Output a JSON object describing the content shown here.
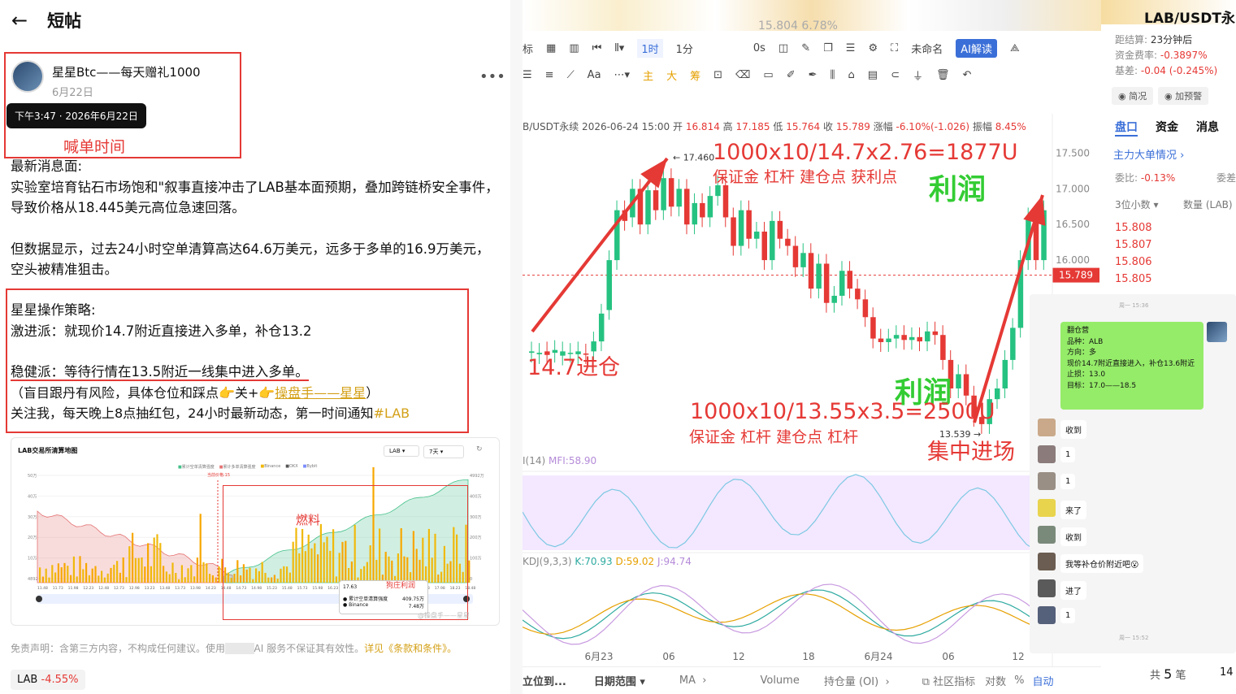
{
  "post": {
    "title": "短帖",
    "author_name": "星星Btc——每天赠礼1000",
    "author_date": "6月22日",
    "tooltip_time": "下午3:47 · 2026年6月22日",
    "annotation_time": "喊单时间",
    "p1": "最新消息面:",
    "p2": "实验室培育钻石市场饱和\"叙事直接冲击了LAB基本面预期，叠加跨链桥安全事件，导致价格从18.445美元高位急速回落。",
    "p3": "但数据显示，过去24小时空单清算高达64.6万美元，远多于多单的16.9万美元，空头被精准狙击。",
    "strategy_title": "星星操作策略:",
    "s1": "激进派：就现价14.7附近直接进入多单，补仓13.2",
    "s2": "稳健派：等待行情在13.5附近一线集中进入多单。",
    "s3a": "（盲目跟丹有风险，具体仓位和踩点",
    "s3b": "关+",
    "s3c": "操盘手——星星",
    "s3d": "）",
    "s4a": "关注我，每天晚上8点抽红包，24小时最新动态，第一时间通知",
    "s4b": "#LAB",
    "heatmap_title": "LAB交易所清算地图",
    "heatmap_label": "燃料",
    "heatmap_annot": "狗庄利润",
    "heatmap_sel1": "LAB",
    "heatmap_sel2": "7天",
    "heatmap_tip_price": "17.63",
    "heatmap_tip_v1": "409.75万",
    "heatmap_tip_v2": "7.48万",
    "heatmap_legend": [
      "累计空单清算强度",
      "累计多单清算强度",
      "Binance",
      "OKX",
      "Bybit"
    ],
    "heatmap_tip_l1": "累计空单清算强度",
    "heatmap_tip_l2": "Binance",
    "heatmap_current": "当前价格:15",
    "heatmap_watermark": "@操盘手——星星",
    "heatmap_y": [
      "50万",
      "40万",
      "30万",
      "20万",
      "10万",
      "4892"
    ],
    "heatmap_y2": [
      "4992万",
      "400万",
      "300万",
      "200万",
      "100万",
      "0"
    ],
    "heatmap_x": [
      "11.48",
      "11.73",
      "11.98",
      "12.23",
      "12.48",
      "12.73",
      "12.98",
      "13.23",
      "13.48",
      "13.73",
      "13.98",
      "14.23",
      "14.48",
      "14.73",
      "14.98",
      "15.23",
      "15.48",
      "15.73",
      "15.98",
      "16.23",
      "16.48",
      "16.73",
      "16.98",
      "17.23",
      "17.48",
      "17.73",
      "17.98",
      "18.23",
      "18.48"
    ],
    "disclaimer_a": "免责声明：含第三方内容，不构成任何建议。使用",
    "disclaimer_b": "AI 服务不保证其有效性。",
    "disclaimer_link": "详见《条款和条件》。",
    "tag_name": "LAB",
    "tag_change": "-4.55%"
  },
  "chart": {
    "header_blur": "15.804 6.78%",
    "toolbar1": [
      "标",
      "1时",
      "1分",
      "0s",
      "未命名",
      "AI解读"
    ],
    "toolbar2": [
      "Aa",
      "主",
      "大",
      "筹"
    ],
    "info_prefix": "B/USDT永续 2026-06-24 15:00 开",
    "open": "16.814",
    "high_label": "高",
    "high": "17.185",
    "low_label": "低",
    "low": "15.764",
    "close_label": "收",
    "close": "15.789",
    "chg_label": "涨幅",
    "chg": "-6.10%(-1.026)",
    "amp_label": "振幅",
    "amp": "8.45%",
    "price_axis": [
      "17.500",
      "17.000",
      "16.500",
      "16.000"
    ],
    "current_price": "15.789",
    "high_mark": "17.460",
    "low_mark": "13.539",
    "ann_top": "1000x10/14.7x2.76=1877U",
    "ann_top_sub": "保证金  杠杆 建仓点 获利点",
    "ann_profit1": "利润",
    "ann_entry": "14.7进仓",
    "ann_profit2": "利润",
    "ann_bottom": "1000x10/13.55x3.5=2500U",
    "ann_bottom_sub": "保证金  杠杆  建仓点  杠杆",
    "ann_focus": "集中进场",
    "mfi": "MFI:58.90",
    "mfi_prefix": "I(14)",
    "kdj_label": "KDJ(9,3,3)",
    "kdj_k": "K:70.93",
    "kdj_d": "D:59.02",
    "kdj_j": "J:94.74",
    "x_labels": [
      "6月23",
      "06",
      "12",
      "18",
      "6月24",
      "06",
      "12"
    ],
    "bottom_bar": [
      "立位到...",
      "日期范围",
      "MA",
      "Volume",
      "持仓量 (OI)",
      "社区指标",
      "对数",
      "%",
      "自动"
    ]
  },
  "side": {
    "pair": "LAB/USDT永",
    "settle_label": "距结算:",
    "settle": "23分钟后",
    "fund_label": "资金费率:",
    "fund": "-0.3897%",
    "basis_label": "基差:",
    "basis": "-0.04 (-0.245%)",
    "btn1": "简况",
    "btn2": "加预警",
    "tabs": [
      "盘口",
      "资金",
      "消息"
    ],
    "big_orders": "主力大单情况",
    "ratio_label": "委比:",
    "ratio": "-0.13%",
    "ratio_right": "委差",
    "decimals": "3位小数",
    "qty": "数量 (LAB)",
    "asks": [
      "15.808",
      "15.807",
      "15.806",
      "15.805"
    ],
    "total_label": "共",
    "total_num": "5",
    "total_unit": "笔",
    "total_right": "14"
  },
  "chat": {
    "time1": "周一 15:36",
    "card": [
      "翻仓营",
      "品种：ALB",
      "方向：多",
      "现价14.7附近直接进入，补仓13.6附近",
      "止损：13.0",
      "目标：17.0——18.5"
    ],
    "msgs": [
      "收到",
      "1",
      "1",
      "来了",
      "收到",
      "我等补仓价附近吧😮",
      "进了",
      "1"
    ],
    "time2": "周一 15:52"
  }
}
